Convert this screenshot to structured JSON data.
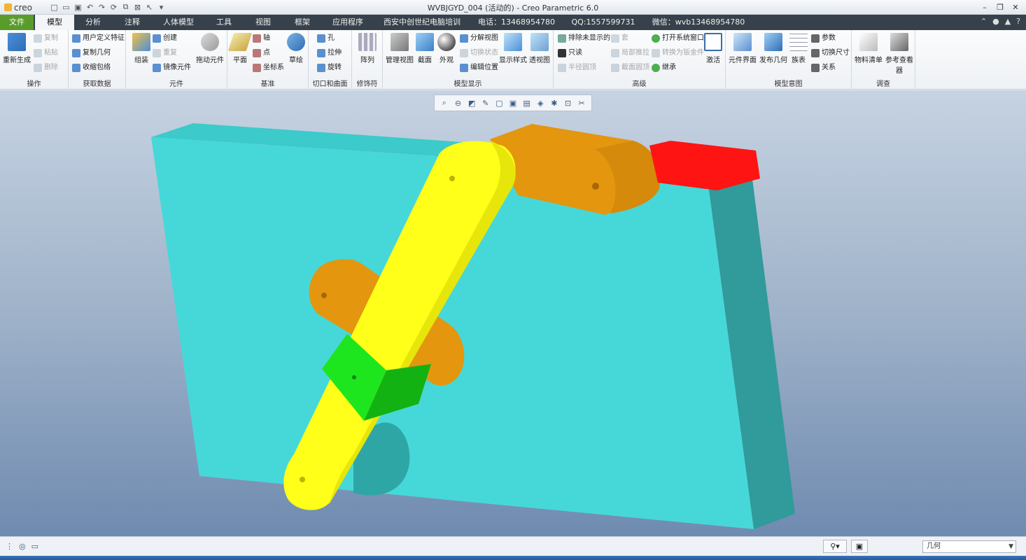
{
  "app": {
    "logo_text": "creo",
    "title": "WVBJGYD_004 (活动的) - Creo Parametric 6.0"
  },
  "tabs": [
    {
      "label": "文件"
    },
    {
      "label": "模型"
    },
    {
      "label": "分析"
    },
    {
      "label": "注释"
    },
    {
      "label": "人体模型"
    },
    {
      "label": "工具"
    },
    {
      "label": "视图"
    },
    {
      "label": "框架"
    },
    {
      "label": "应用程序"
    },
    {
      "label": "西安中创世纪电脑培训"
    },
    {
      "label": "电话：13468954780"
    },
    {
      "label": "QQ:1557599731"
    },
    {
      "label": "微信：wvb13468954780"
    }
  ],
  "ribbon": {
    "operations": {
      "label": "操作",
      "regenerate": "重新生成",
      "copy": "复制",
      "paste": "粘贴",
      "delete": "删除"
    },
    "get_data": {
      "label": "获取数据",
      "udf": "用户定义特征",
      "copy_geom": "复制几何",
      "shrinkwrap": "收缩包络"
    },
    "component": {
      "label": "元件",
      "assemble": "组装",
      "create": "创建",
      "repeat": "重复",
      "mirror": "镜像元件",
      "drag": "拖动元件"
    },
    "datum": {
      "label": "基准",
      "plane": "平面",
      "axis": "轴",
      "point": "点",
      "csys": "坐标系",
      "sketch": "草绘"
    },
    "cut_surface": {
      "label": "切口和曲面",
      "hole": "孔",
      "extrude": "拉伸",
      "revolve": "旋转"
    },
    "modifiers": {
      "label": "修饰符",
      "pattern": "阵列"
    },
    "model_display": {
      "label": "模型显示",
      "manage_views": "管理视图",
      "section": "截面",
      "appearance": "外观",
      "explode": "分解视图",
      "toggle_state": "切换状态",
      "edit_position": "编辑位置",
      "display_style": "显示样式",
      "perspective": "透视图"
    },
    "advanced": {
      "label": "高级",
      "exclude_hidden": "排除未显示的",
      "read_only": "只读",
      "radius_top": "半径圆顶",
      "item1": "套",
      "local_push": "局部推拉",
      "section_dome": "截面圆顶",
      "open_system_window": "打开系统窗口",
      "convert_sheetmetal": "转换为钣金件",
      "inherit": "继承",
      "activate": "激活"
    },
    "model_intent": {
      "label": "模型意图",
      "component_interface": "元件界面",
      "publish_geom": "发布几何",
      "family_table": "族表",
      "params": "参数",
      "switch_dims": "切换尺寸",
      "relations": "关系"
    },
    "investigate": {
      "label": "调查",
      "bom": "物料清单",
      "ref_viewer": "参考查看器"
    }
  },
  "status": {
    "filter_value": "几何"
  },
  "colors": {
    "plate_face": "#46d8d8",
    "plate_side": "#319a9a",
    "plate_top": "#3ccaca",
    "link_yellow": "#ffff1a",
    "link_orange": "#e4960e",
    "slider_green": "#1ee61e",
    "tip_red": "#ff1414",
    "file_tab": "#5a9c2a",
    "tabbar_bg": "#37414b"
  }
}
